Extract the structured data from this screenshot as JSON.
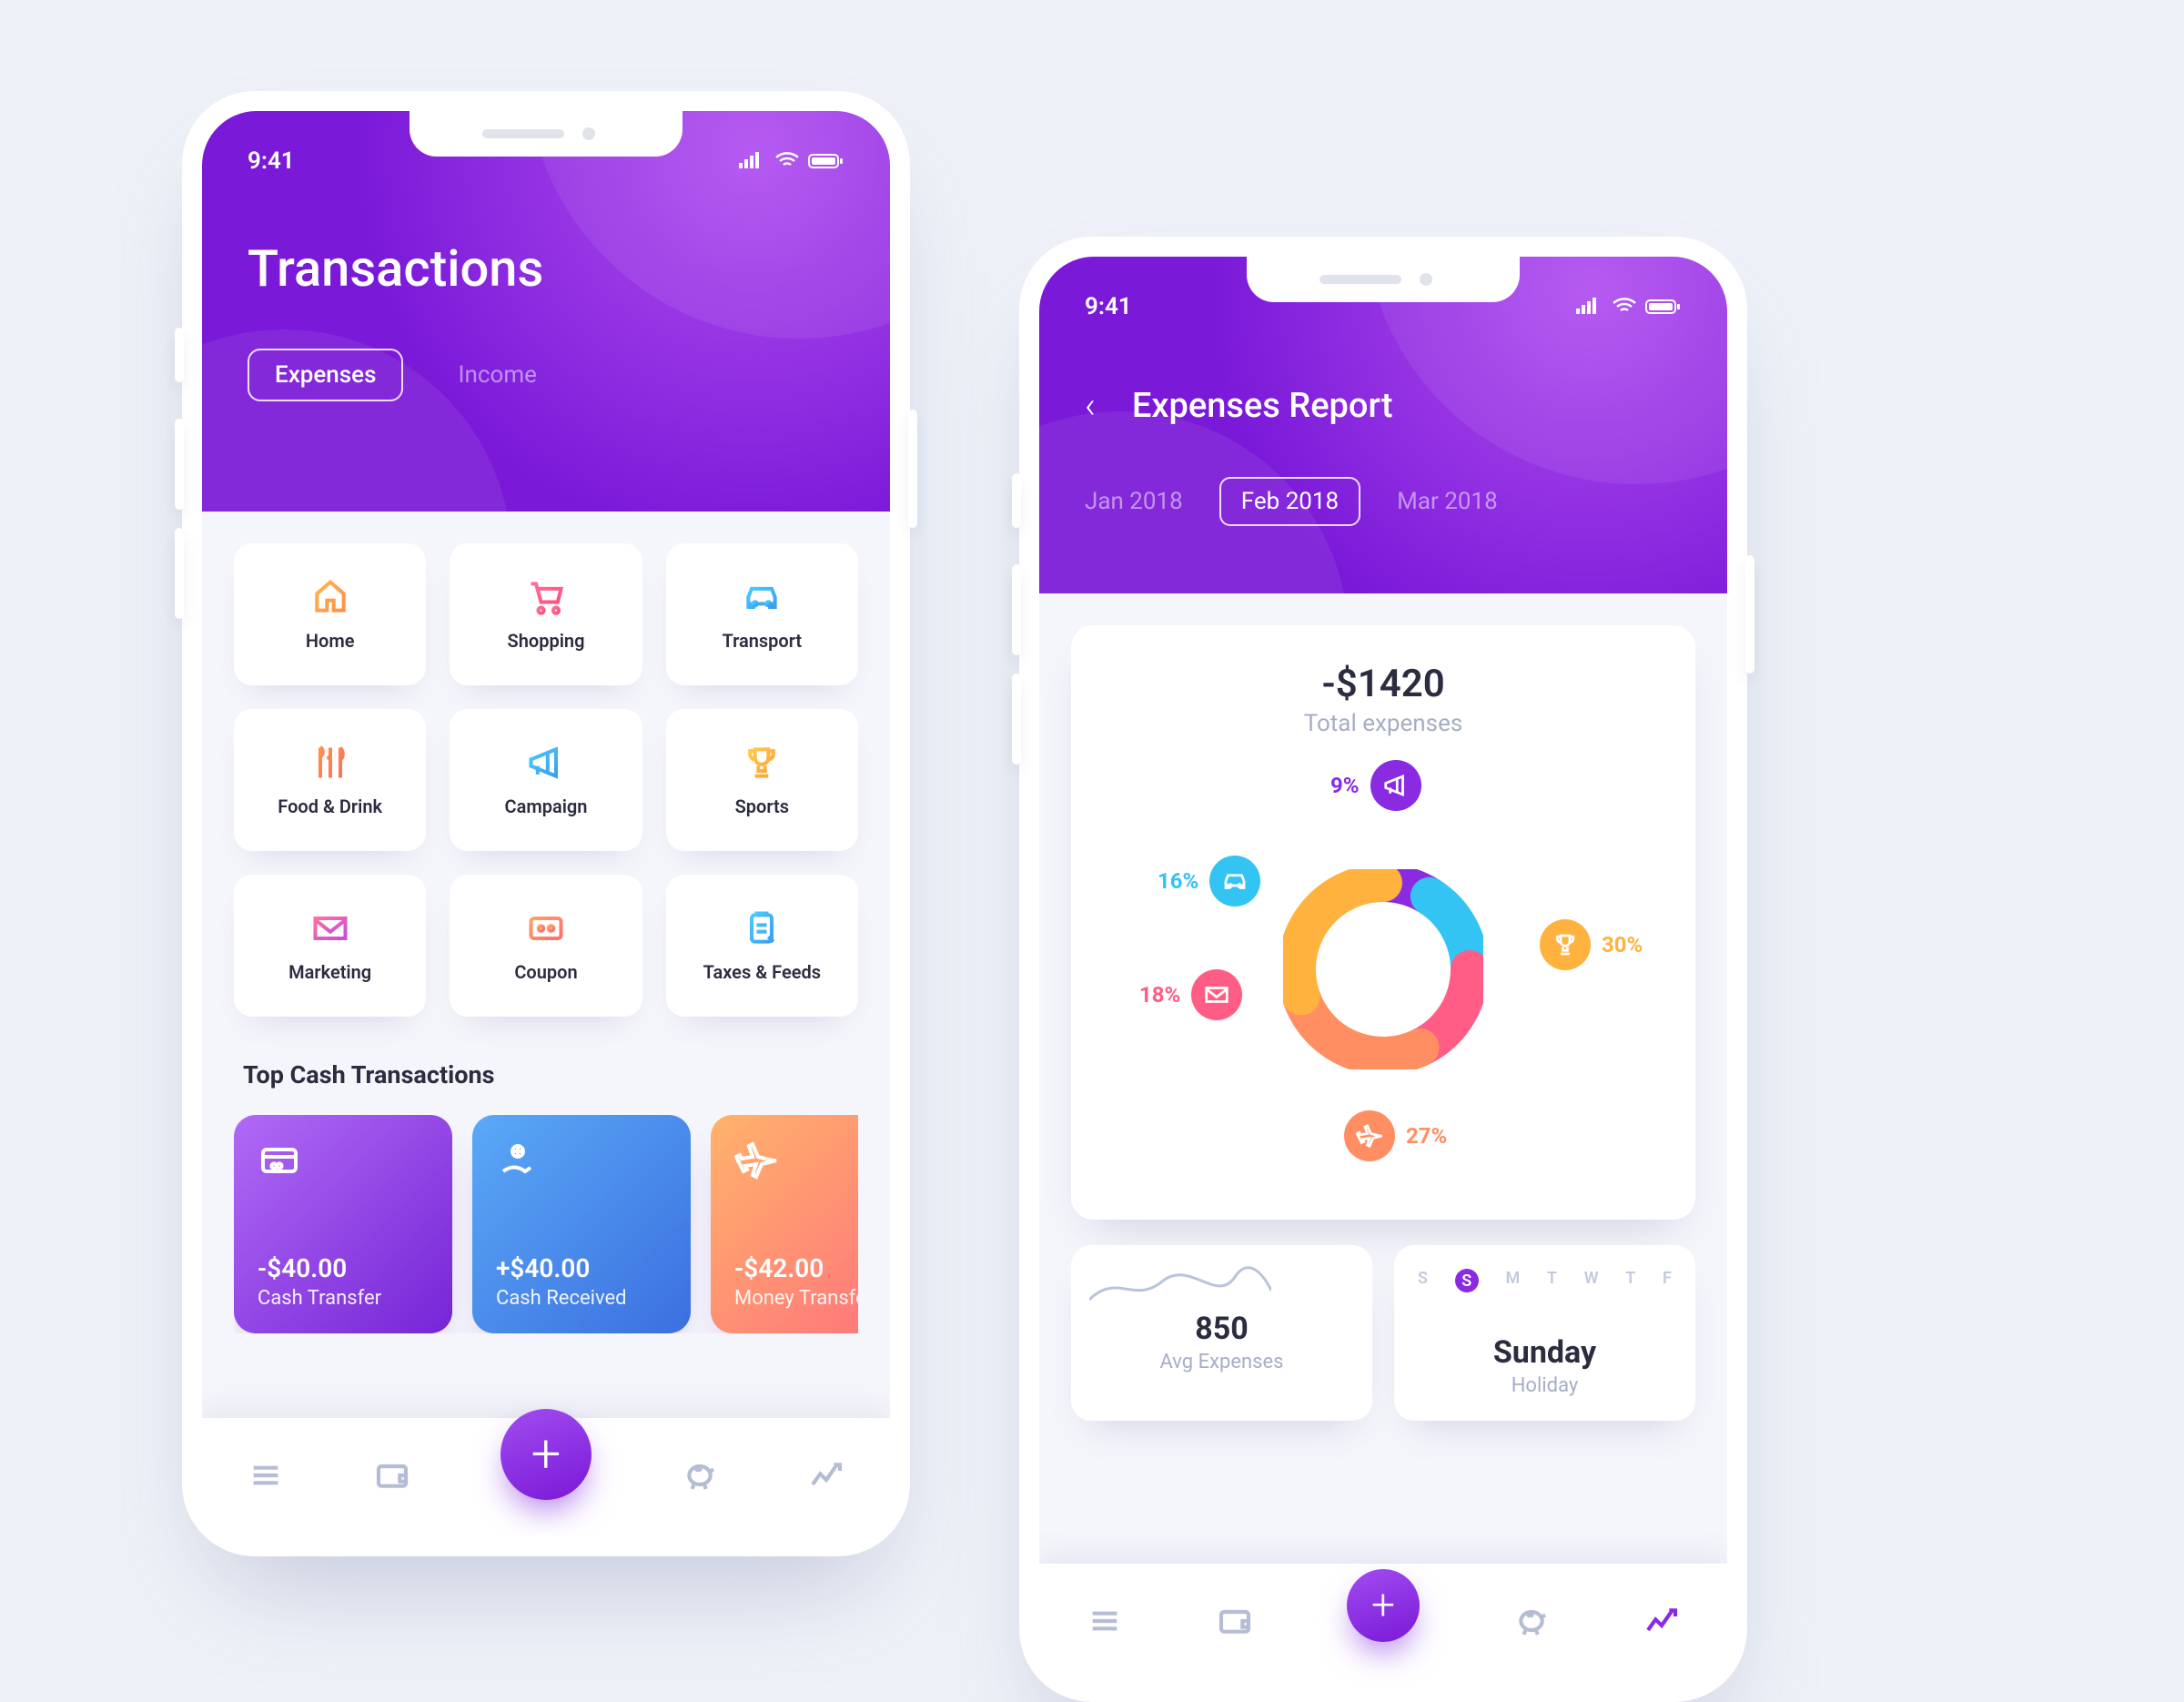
{
  "status": {
    "time": "9:41"
  },
  "left": {
    "title": "Transactions",
    "tabs": {
      "active": "Expenses",
      "other": "Income"
    },
    "categories": [
      {
        "label": "Home",
        "icon": "home"
      },
      {
        "label": "Shopping",
        "icon": "cart"
      },
      {
        "label": "Transport",
        "icon": "car"
      },
      {
        "label": "Food & Drink",
        "icon": "food"
      },
      {
        "label": "Campaign",
        "icon": "megaphone"
      },
      {
        "label": "Sports",
        "icon": "trophy"
      },
      {
        "label": "Marketing",
        "icon": "mail"
      },
      {
        "label": "Coupon",
        "icon": "coupon"
      },
      {
        "label": "Taxes & Feeds",
        "icon": "clipboard"
      }
    ],
    "section_title": "Top Cash Transactions",
    "transactions": [
      {
        "amount": "-$40.00",
        "label": "Cash Transfer",
        "icon": "card"
      },
      {
        "amount": "+$40.00",
        "label": "Cash Received",
        "icon": "hand-coin"
      },
      {
        "amount": "-$42.00",
        "label": "Money Transfer",
        "icon": "plane"
      }
    ]
  },
  "right": {
    "title": "Expenses Report",
    "months": {
      "prev": "Jan 2018",
      "current": "Feb 2018",
      "next": "Mar 2018"
    },
    "total": {
      "amount": "-$1420",
      "label": "Total expenses"
    },
    "avg_card": {
      "value": "850",
      "label": "Avg Expenses"
    },
    "day_card": {
      "days": [
        "S",
        "S",
        "M",
        "T",
        "W",
        "T",
        "F"
      ],
      "selected_index": 1,
      "value": "Sunday",
      "label": "Holiday"
    }
  },
  "chart_data": {
    "type": "pie",
    "title": "Expenses Report — Feb 2018",
    "total": -1420,
    "series": [
      {
        "name": "Campaign",
        "value_pct": 9,
        "color": "#8a2be2",
        "icon": "megaphone"
      },
      {
        "name": "Transport",
        "value_pct": 16,
        "color": "#33c4f4",
        "icon": "car"
      },
      {
        "name": "Marketing",
        "value_pct": 18,
        "color": "#ff5d85",
        "icon": "mail"
      },
      {
        "name": "Travel",
        "value_pct": 27,
        "color": "#ff8f63",
        "icon": "plane"
      },
      {
        "name": "Sports",
        "value_pct": 30,
        "color": "#ffb23e",
        "icon": "trophy"
      }
    ]
  },
  "colors": {
    "purple1": "#8a2be2",
    "purple2": "#7a19d8",
    "cyan": "#33c4f4",
    "pink": "#ff5d85",
    "orange": "#ff8f63",
    "gold": "#ffb23e"
  }
}
